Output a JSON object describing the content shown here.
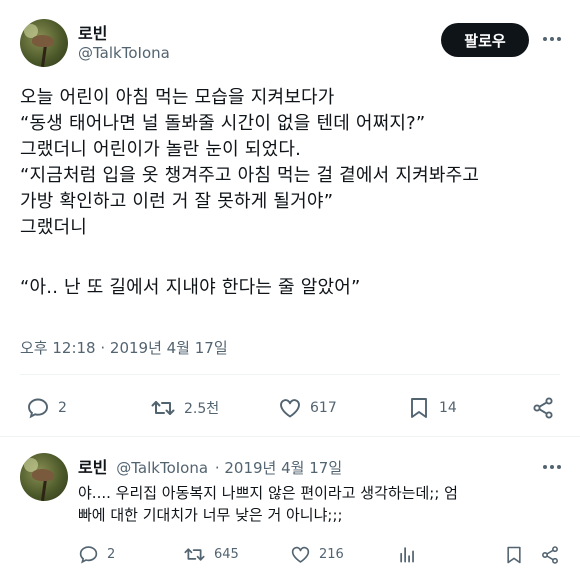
{
  "main_tweet": {
    "author_name": "로빈",
    "author_handle": "@TalkToIona",
    "follow_label": "팔로우",
    "lines": [
      "오늘 어린이 아침 먹는 모습을 지켜보다가",
      "“동생 태어나면 널 돌봐줄 시간이 없을 텐데 어쩌지?”",
      "그랬더니 어린이가 놀란 눈이 되었다.",
      "“지금처럼 입을 옷 챙겨주고 아침 먹는 걸 곁에서 지켜봐주고",
      "가방 확인하고 이런 거 잘 못하게 될거야”",
      "그랬더니",
      "",
      "“아.. 난 또 길에서 지내야 한다는 줄 알았어”"
    ],
    "timestamp": "오후 12:18 · 2019년 4월 17일",
    "stats": {
      "replies": "2",
      "retweets": "2.5천",
      "likes": "617",
      "bookmarks": "14"
    }
  },
  "reply": {
    "author_name": "로빈",
    "author_handle": "@TalkToIona",
    "date": "· 2019년 4월 17일",
    "lines": [
      "야.... 우리집 아동복지 나쁘지 않은 편이라고 생각하는데;; 엄",
      "빠에 대한 기대치가 너무 낮은 거 아니냐;;;"
    ],
    "stats": {
      "replies": "2",
      "retweets": "645",
      "likes": "216"
    }
  },
  "colors": {
    "text": "#0f1419",
    "secondary": "#536471",
    "divider": "#eff3f4",
    "follow_bg": "#0f1419"
  }
}
